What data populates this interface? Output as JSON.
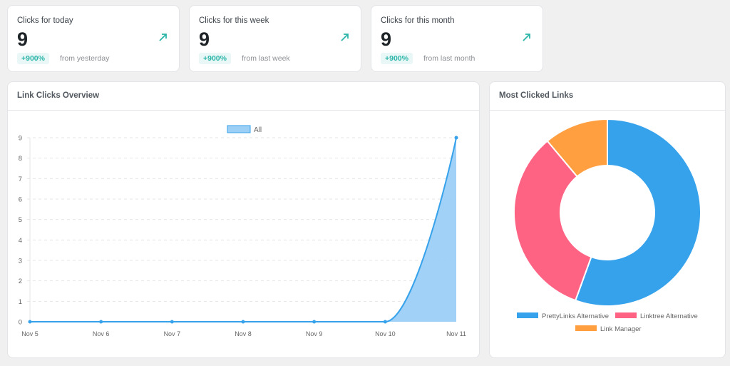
{
  "stats": [
    {
      "label": "Clicks for today",
      "value": "9",
      "change": "+900%",
      "sub": "from yesterday",
      "icon": "trend-up-arrow-icon"
    },
    {
      "label": "Clicks for this week",
      "value": "9",
      "change": "+900%",
      "sub": "from last week",
      "icon": "trend-up-arrow-icon"
    },
    {
      "label": "Clicks for this month",
      "value": "9",
      "change": "+900%",
      "sub": "from last month",
      "icon": "trend-up-arrow-icon"
    }
  ],
  "colors": {
    "accent": "#2bb5a8",
    "line": "#36a2eb",
    "fill": "#9ccff5",
    "pink": "#ff6384",
    "orange": "#ff9f40"
  },
  "overview": {
    "title": "Link Clicks Overview"
  },
  "links": {
    "title": "Most Clicked Links"
  },
  "chart_data": [
    {
      "type": "area",
      "title": "Link Clicks Overview",
      "legend": [
        "All"
      ],
      "legend_position": "top",
      "categories": [
        "Nov 5",
        "Nov 6",
        "Nov 7",
        "Nov 8",
        "Nov 9",
        "Nov 10",
        "Nov 11"
      ],
      "series": [
        {
          "name": "All",
          "values": [
            0,
            0,
            0,
            0,
            0,
            0,
            9
          ]
        }
      ],
      "yticks": [
        0,
        1,
        2,
        3,
        4,
        5,
        6,
        7,
        8,
        9
      ],
      "ylim": [
        0,
        9
      ],
      "grid": true
    },
    {
      "type": "pie",
      "title": "Most Clicked Links",
      "donut": true,
      "labels": [
        "PrettyLinks Alternative",
        "Linktree Alternative",
        "Link Manager"
      ],
      "values": [
        5,
        3,
        1
      ],
      "colors": [
        "#36a2eb",
        "#ff6384",
        "#ff9f40"
      ],
      "legend_position": "bottom"
    }
  ]
}
